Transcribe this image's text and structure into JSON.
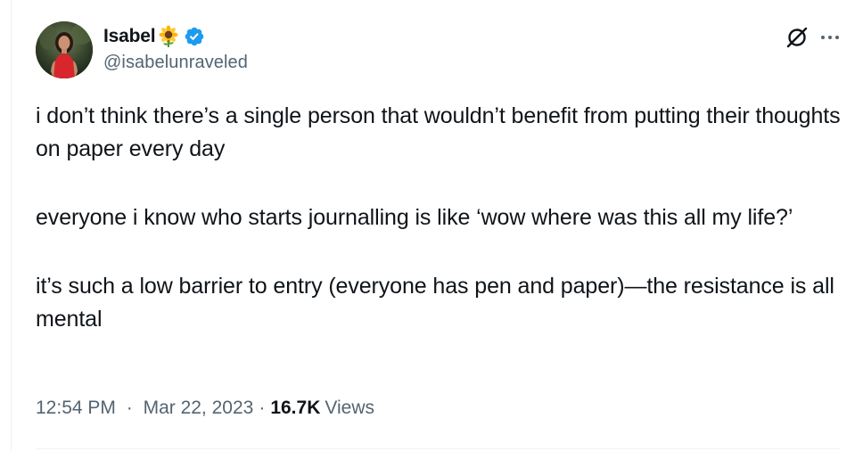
{
  "author": {
    "display_name": "Isabel",
    "name_emoji": "sunflower",
    "handle": "@isabelunraveled",
    "verified": true,
    "verified_color": "#1d9bf0",
    "avatar": "profile-photo-person-in-red-dress"
  },
  "header_actions": {
    "grok_icon": "grok-icon",
    "more_icon": "more-horizontal-icon"
  },
  "tweet": {
    "paragraphs": [
      "i don’t think there’s a single person that wouldn’t benefit from putting their thoughts on paper every day",
      "everyone i know who starts journalling is like ‘wow where was this all my life?’",
      "it’s such a low barrier to entry (everyone has pen and paper)—the resistance is all mental"
    ]
  },
  "meta": {
    "time": "12:54 PM",
    "separator": "·",
    "date": "Mar 22, 2023",
    "views_count": "16.7K",
    "views_label": "Views"
  },
  "colors": {
    "text_primary": "#0f1419",
    "text_secondary": "#536471",
    "divider": "#eff3f4",
    "background": "#ffffff"
  }
}
